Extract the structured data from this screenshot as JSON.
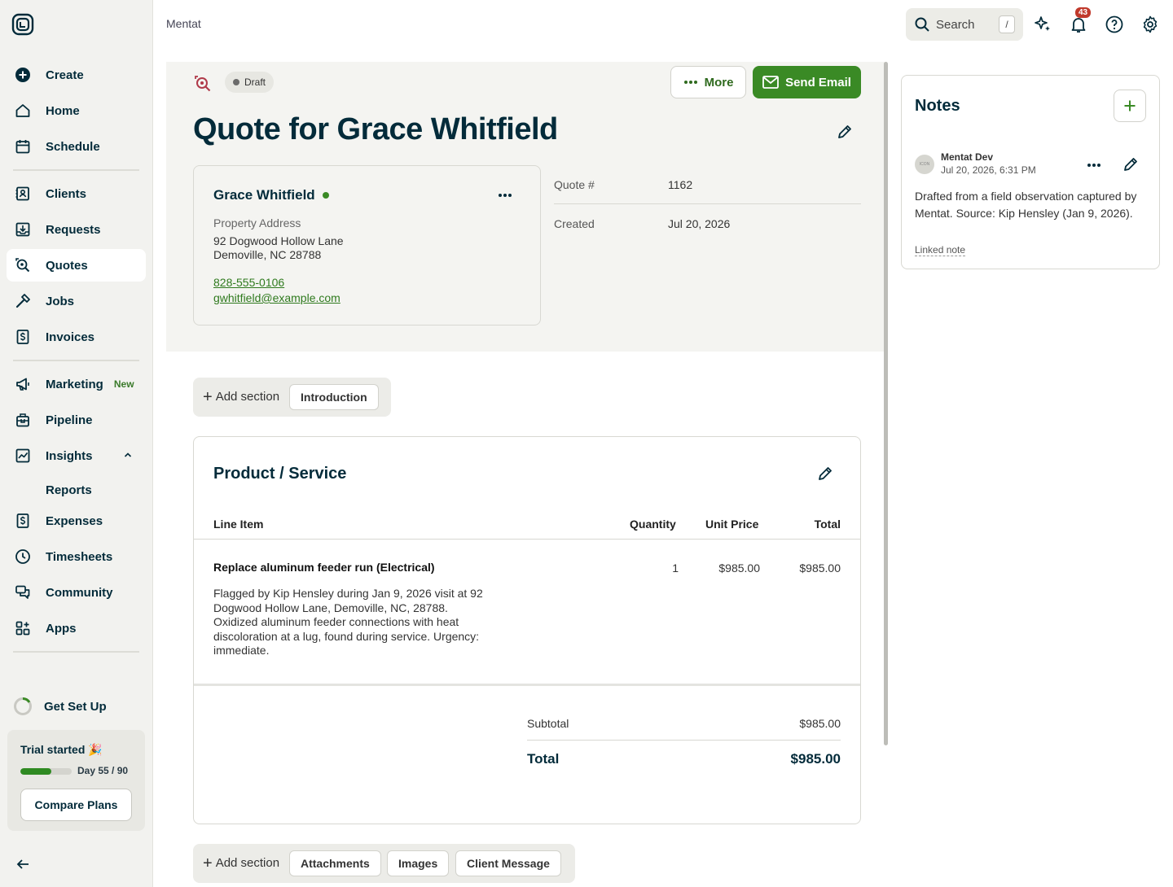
{
  "app": {
    "breadcrumb": "Mentat"
  },
  "sidebar": {
    "items": [
      {
        "label": "Create"
      },
      {
        "label": "Home"
      },
      {
        "label": "Schedule"
      },
      {
        "label": "Clients"
      },
      {
        "label": "Requests"
      },
      {
        "label": "Quotes"
      },
      {
        "label": "Jobs"
      },
      {
        "label": "Invoices"
      },
      {
        "label": "Marketing",
        "badge": "New"
      },
      {
        "label": "Pipeline"
      },
      {
        "label": "Insights"
      },
      {
        "label": "Reports"
      },
      {
        "label": "Expenses"
      },
      {
        "label": "Timesheets"
      },
      {
        "label": "Community"
      },
      {
        "label": "Apps"
      },
      {
        "label": "Get Set Up"
      }
    ],
    "active": "Quotes",
    "trial": {
      "title": "Trial started 🎉",
      "days": "Day 55 / 90",
      "progress": 0.61,
      "button": "Compare Plans"
    }
  },
  "topbar": {
    "search_placeholder": "Search",
    "search_shortcut": "/",
    "notification_count": "43"
  },
  "quote": {
    "status": "Draft",
    "more_label": "More",
    "send_label": "Send Email",
    "title": "Quote for Grace Whitfield",
    "client": {
      "name": "Grace Whitfield",
      "address_label": "Property Address",
      "address_line1": "92 Dogwood Hollow Lane",
      "address_line2": "Demoville, NC 28788",
      "phone": "828-555-0106",
      "email": "gwhitfield@example.com"
    },
    "meta": {
      "number_label": "Quote #",
      "number": "1162",
      "created_label": "Created",
      "created": "Jul 20, 2026"
    }
  },
  "sections_top": {
    "add_label": "Add section",
    "buttons": [
      "Introduction"
    ]
  },
  "product": {
    "title": "Product / Service",
    "headers": {
      "item": "Line Item",
      "qty": "Quantity",
      "unit": "Unit Price",
      "total": "Total"
    },
    "line": {
      "name": "Replace aluminum feeder run (Electrical)",
      "description": "Flagged by Kip Hensley during Jan 9, 2026 visit at 92 Dogwood Hollow Lane, Demoville, NC, 28788. Oxidized aluminum feeder connections with heat discoloration at a lug, found during service. Urgency: immediate.",
      "qty": "1",
      "unit": "$985.00",
      "total": "$985.00"
    },
    "subtotal_label": "Subtotal",
    "subtotal": "$985.00",
    "total_label": "Total",
    "total": "$985.00"
  },
  "sections_bottom": {
    "add_label": "Add section",
    "buttons": [
      "Attachments",
      "Images",
      "Client Message"
    ]
  },
  "notes": {
    "title": "Notes",
    "entry": {
      "avatar": "ICON",
      "author": "Mentat Dev",
      "date": "Jul 20, 2026, 6:31 PM",
      "body": "Drafted from a field observation captured by Mentat. Source: Kip Hensley (Jan 9, 2026).",
      "link": "Linked note"
    }
  },
  "colors": {
    "brand_green": "#3a8a25",
    "text_dark": "#032b3a",
    "sidebar_bg": "#f2f2ef",
    "badge_red": "#c0392b"
  }
}
